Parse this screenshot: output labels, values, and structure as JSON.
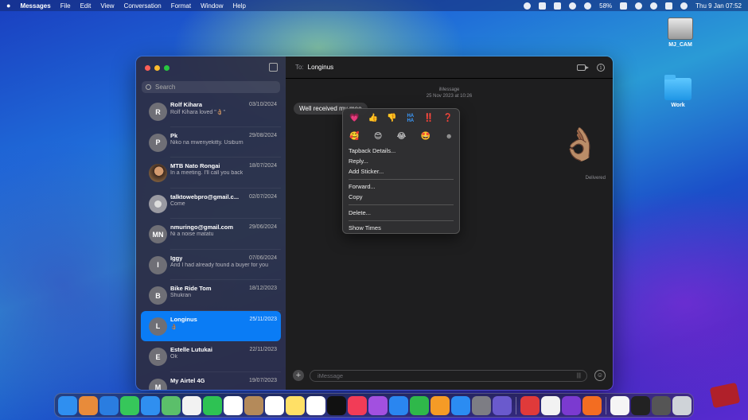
{
  "menubar": {
    "app": "Messages",
    "items": [
      "File",
      "Edit",
      "View",
      "Conversation",
      "Format",
      "Window",
      "Help"
    ],
    "battery": "58%",
    "clock": "Thu 9 Jan  07:52"
  },
  "desktop": {
    "icons": [
      {
        "label": "MJ_CAM",
        "icon": "drive-icon"
      },
      {
        "label": "Work",
        "icon": "folder-icon"
      }
    ]
  },
  "sidebar": {
    "search_placeholder": "Search",
    "conversations": [
      {
        "name": "Rolf Kihara",
        "date": "03/10/2024",
        "preview": "Rolf Kihara loved \"👌🏽\"",
        "initial": "R",
        "avatar": "initial"
      },
      {
        "name": "Pk",
        "date": "29/08/2024",
        "preview": "Niko na mwenyekitty. Usiburn",
        "initial": "P",
        "avatar": "initial"
      },
      {
        "name": "MTB Nato Rongai",
        "date": "18/07/2024",
        "preview": "In a meeting. I'll call you back",
        "initial": "",
        "avatar": "photo"
      },
      {
        "name": "talktowebpro@gmail.c...",
        "date": "02/07/2024",
        "preview": "Come",
        "initial": "",
        "avatar": "generic"
      },
      {
        "name": "nmuringo@gmail.com",
        "date": "29/06/2024",
        "preview": "Ni a noise matatu",
        "initial": "MN",
        "avatar": "initial"
      },
      {
        "name": "Iggy",
        "date": "07/06/2024",
        "preview": "And I had already found a buyer for you",
        "initial": "I",
        "avatar": "initial"
      },
      {
        "name": "Bike Ride Tom",
        "date": "18/12/2023",
        "preview": "Shukran",
        "initial": "B",
        "avatar": "initial"
      },
      {
        "name": "Longinus",
        "date": "25/11/2023",
        "preview": "👌🏽",
        "initial": "L",
        "avatar": "initial",
        "active": true
      },
      {
        "name": "Estelle Lutukai",
        "date": "22/11/2023",
        "preview": "Ok",
        "initial": "E",
        "avatar": "initial"
      },
      {
        "name": "My Airtel 4G",
        "date": "19/07/2023",
        "preview": "",
        "initial": "M",
        "avatar": "initial"
      }
    ]
  },
  "chat": {
    "to_label": "To:",
    "recipient": "Longinus",
    "service": "iMessage",
    "timestamp": "25 Nov 2023 at 10:26",
    "message": "Well received my mee",
    "big_emoji": "👌🏽",
    "status": "Delivered",
    "input_placeholder": "iMessage"
  },
  "context_menu": {
    "tapbacks": [
      "💗",
      "👍",
      "👎",
      "HA HA",
      "‼️",
      "❓"
    ],
    "stickers": [
      "🥰",
      "😊",
      "😂",
      "🤩"
    ],
    "items": [
      "Tapback Details...",
      "Reply...",
      "Add Sticker...",
      "Forward...",
      "Copy",
      "Delete...",
      "Show Times"
    ]
  },
  "colors": {
    "accent": "#0a7cf5",
    "sidebar_bg": "#2c2c42",
    "chat_bg": "#1e1e1f",
    "bubble_bg": "#3a3a3c"
  },
  "dock": {
    "apps": [
      {
        "name": "finder",
        "color": "#2f8ff0"
      },
      {
        "name": "launchpad",
        "color": "#e88b3a"
      },
      {
        "name": "safari",
        "color": "#2a7de0"
      },
      {
        "name": "messages",
        "color": "#36c75a"
      },
      {
        "name": "mail",
        "color": "#2f8ff0"
      },
      {
        "name": "maps",
        "color": "#5bbf6a"
      },
      {
        "name": "photos",
        "color": "#f2f2f2"
      },
      {
        "name": "facetime",
        "color": "#2ec253"
      },
      {
        "name": "calendar",
        "color": "#ffffff"
      },
      {
        "name": "contacts",
        "color": "#b48a5a"
      },
      {
        "name": "reminders",
        "color": "#ffffff"
      },
      {
        "name": "notes",
        "color": "#ffe066"
      },
      {
        "name": "freeform",
        "color": "#ffffff"
      },
      {
        "name": "tv",
        "color": "#111111"
      },
      {
        "name": "music",
        "color": "#f23c57"
      },
      {
        "name": "podcasts",
        "color": "#a250e0"
      },
      {
        "name": "keynote",
        "color": "#2a86f0"
      },
      {
        "name": "numbers",
        "color": "#2fb84a"
      },
      {
        "name": "pages",
        "color": "#f59b26"
      },
      {
        "name": "app-store",
        "color": "#2b8cf2"
      },
      {
        "name": "system-settings",
        "color": "#7d7d84"
      },
      {
        "name": "iphone-mirroring",
        "color": "#6a5acd"
      },
      {
        "name": "anydesk",
        "color": "#e03a3a"
      },
      {
        "name": "chrome",
        "color": "#f2f2f2"
      },
      {
        "name": "affinity",
        "color": "#7b3ad0"
      },
      {
        "name": "firefox",
        "color": "#f36d21"
      },
      {
        "name": "font-book",
        "color": "#f5f5f5"
      },
      {
        "name": "terminal",
        "color": "#222222"
      },
      {
        "name": "screen-recorder",
        "color": "#555555"
      },
      {
        "name": "trash",
        "color": "#cfd3d8"
      }
    ]
  }
}
